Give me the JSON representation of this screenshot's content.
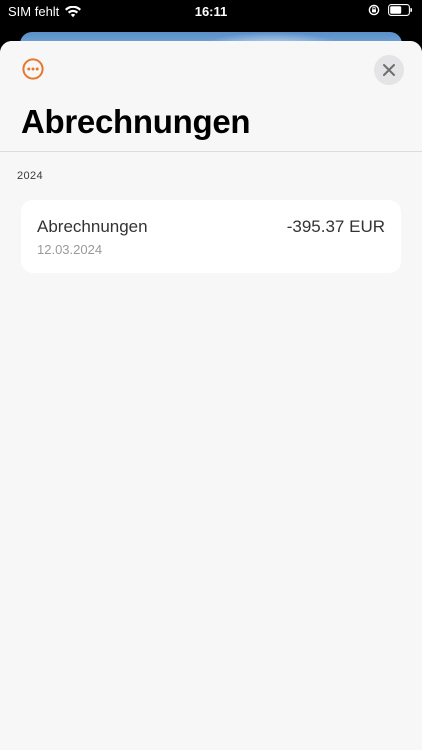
{
  "status_bar": {
    "carrier": "SIM fehlt",
    "time": "16:11",
    "icons": [
      "wifi-icon",
      "lock-rotation-icon",
      "battery-icon"
    ]
  },
  "sheet": {
    "more_icon": "ellipsis-circle-icon",
    "close_icon": "close-icon",
    "title": "Abrechnungen",
    "accent_color": "#E8772E"
  },
  "sections": [
    {
      "header": "2024",
      "items": [
        {
          "title": "Abrechnungen",
          "date": "12.03.2024",
          "amount": "-395.37 EUR"
        }
      ]
    }
  ]
}
